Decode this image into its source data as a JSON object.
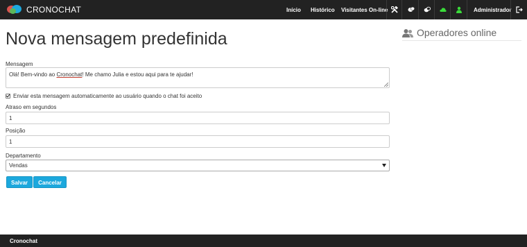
{
  "app": {
    "brand": "CRONOCHAT"
  },
  "nav": {
    "links": [
      "Início",
      "Histórico",
      "Visitantes On-line"
    ],
    "icons": [
      "tools-icon",
      "bubbles-icon",
      "bubbles-outline-icon",
      "cloud-icon",
      "user-icon",
      "logout-icon"
    ],
    "status_color": "#3adb3a",
    "user": "Administrador"
  },
  "page": {
    "title": "Nova mensagem predefinida"
  },
  "form": {
    "message_label": "Mensagem",
    "message_value_before": "Olá! Bem-vindo ao ",
    "message_value_brand": "Cronochat",
    "message_value_after": "! Me chamo Julia e estou aqui para te ajudar!",
    "auto_send_label": "Enviar esta mensagem automaticamente ao usuário quando o chat foi aceito",
    "auto_send_checked": true,
    "delay_label": "Atraso em segundos",
    "delay_value": "1",
    "position_label": "Posição",
    "position_value": "1",
    "department_label": "Departamento",
    "department_value": "Vendas",
    "save_label": "Salvar",
    "cancel_label": "Cancelar",
    "accent": "#1ca8dd"
  },
  "sidebar": {
    "title": "Operadores online"
  },
  "footer": {
    "text": "Cronochat"
  }
}
